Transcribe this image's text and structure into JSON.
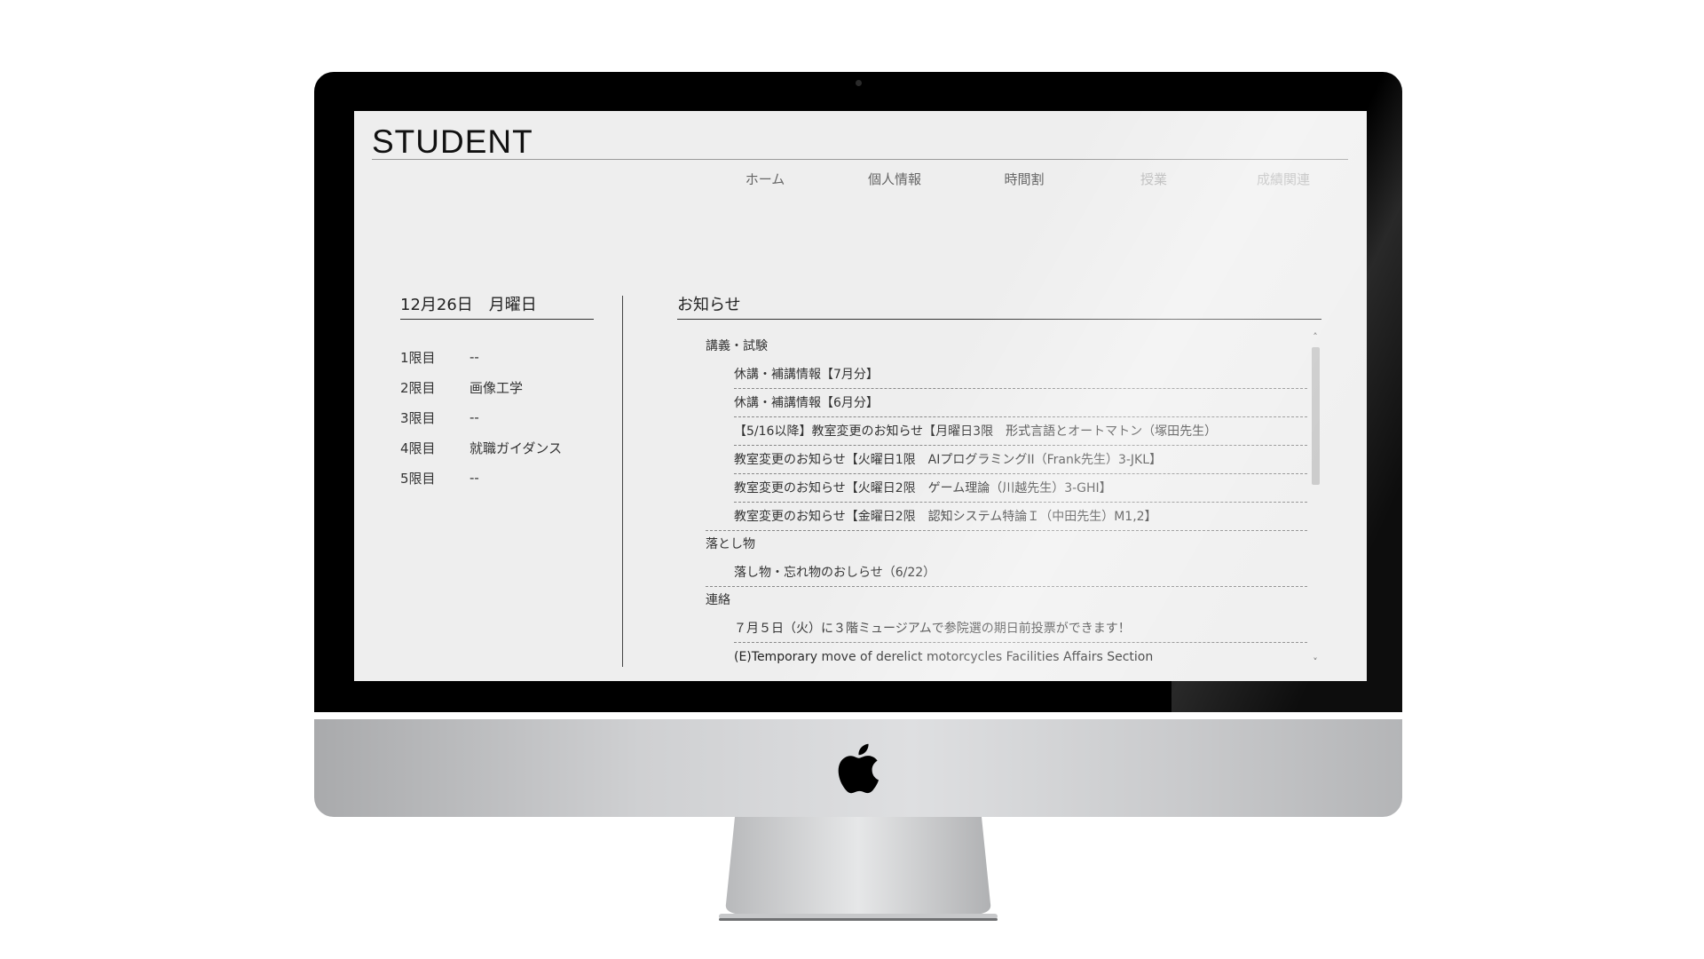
{
  "site": {
    "title": "STUDENT"
  },
  "nav": {
    "items": [
      {
        "label": "ホーム"
      },
      {
        "label": "個人情報"
      },
      {
        "label": "時間割"
      },
      {
        "label": "授業"
      },
      {
        "label": "成績関連"
      }
    ]
  },
  "schedule": {
    "date_heading": "12月26日　月曜日",
    "periods": [
      {
        "label": "1限目",
        "subject": "--"
      },
      {
        "label": "2限目",
        "subject": "画像工学"
      },
      {
        "label": "3限目",
        "subject": "--"
      },
      {
        "label": "4限目",
        "subject": "就職ガイダンス"
      },
      {
        "label": "5限目",
        "subject": "--"
      }
    ]
  },
  "notices": {
    "heading": "お知らせ",
    "groups": [
      {
        "category": "講義・試験",
        "items": [
          "休講・補講情報【7月分】",
          "休講・補講情報【6月分】",
          "【5/16以降】教室変更のお知らせ【月曜日3限　形式言語とオートマトン（塚田先生）",
          "教室変更のお知らせ【火曜日1限　AIプログラミングII（Frank先生）3-JKL】",
          "教室変更のお知らせ【火曜日2限　ゲーム理論（川越先生）3-GHI】",
          "教室変更のお知らせ【金曜日2限　認知システム特論Ｉ（中田先生）M1,2】"
        ]
      },
      {
        "category": "落とし物",
        "items": [
          "落し物・忘れ物のおしらせ（6/22）"
        ]
      },
      {
        "category": "連絡",
        "items": [
          "７月５日（火）に３階ミュージアムで参院選の期日前投票ができます！",
          "(E)Temporary move of derelict motorcycles Facilities Affairs Section"
        ]
      }
    ]
  },
  "scrollbar": {
    "up_arrow": "˄",
    "down_arrow": "˅"
  }
}
